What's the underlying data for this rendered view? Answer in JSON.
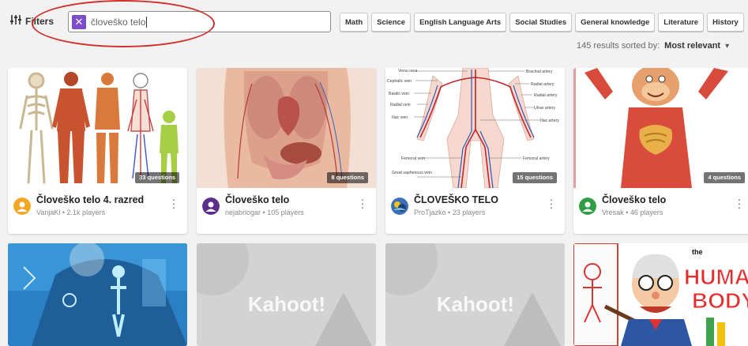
{
  "toolbar": {
    "filters_label": "Filters",
    "search_value": "človeško telo"
  },
  "categories": [
    "Math",
    "Science",
    "English Language Arts",
    "Social Studies",
    "General knowledge",
    "Literature",
    "History"
  ],
  "results": {
    "summary": "145 results sorted by:",
    "sort_value": "Most relevant"
  },
  "cards": [
    {
      "title": "Človeško telo 4. razred",
      "author": "VanjaKl",
      "players": "2.1k players",
      "questions": "33 questions",
      "avatar_color": "#f5a623"
    },
    {
      "title": "Človeško telo",
      "author": "nejabrlogar",
      "players": "105 players",
      "questions": "8 questions",
      "avatar_color": "#5b2d8e"
    },
    {
      "title": "ČLOVEŠKO TELO",
      "author": "ProTjazko",
      "players": "23 players",
      "questions": "15 questions",
      "avatar_color": "#3b6fb6"
    },
    {
      "title": "Človeško telo",
      "author": "Vresak",
      "players": "46 players",
      "questions": "4 questions",
      "avatar_color": "#2f9e44"
    }
  ],
  "anatomy_labels": {
    "left": [
      "Vena cava",
      "Cephalic vein",
      "Basilic vein",
      "Radial vein",
      "Iliac vein",
      "Femoral vein",
      "Great saphenous vein"
    ],
    "right": [
      "Brachial artery",
      "Radial artery",
      "Radial artery",
      "Ulnar artery",
      "Iliac artery",
      "Femoral artery"
    ]
  },
  "placeholder_brand": "Kahoot!",
  "poster_text": [
    "the",
    "HUMAN",
    "BODY"
  ],
  "separator": "•"
}
